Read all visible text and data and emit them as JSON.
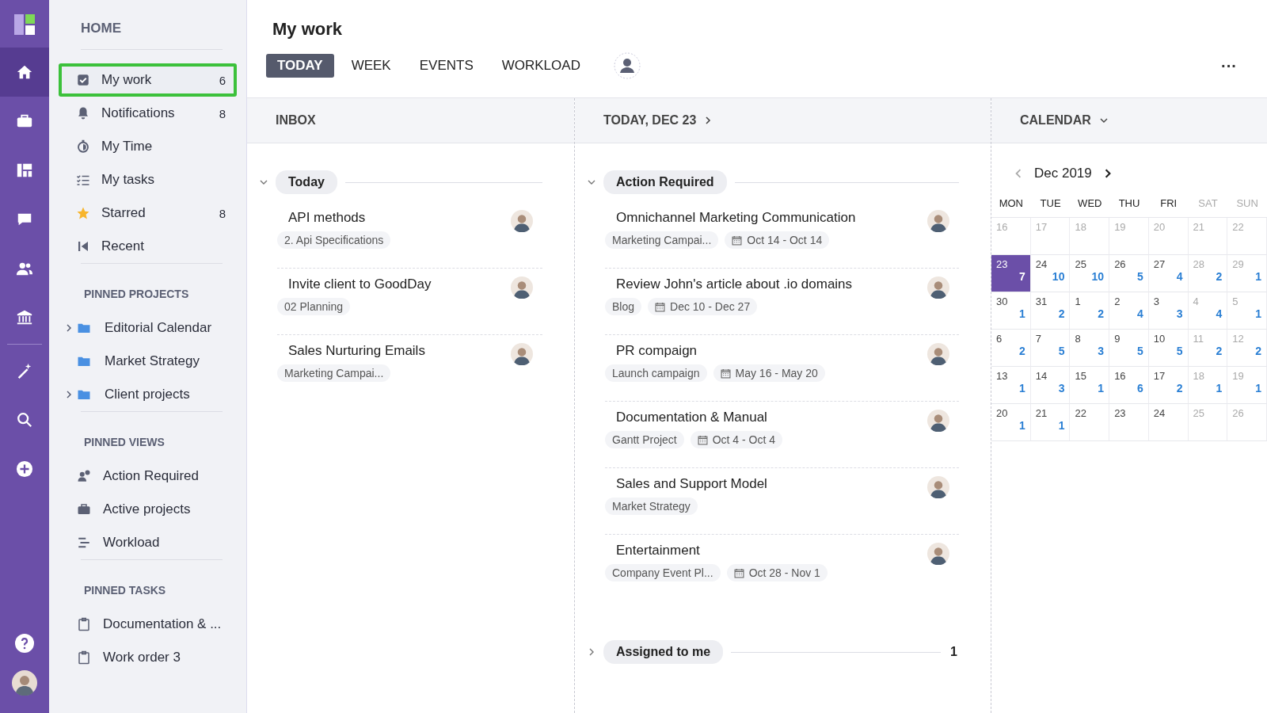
{
  "rail": {
    "items": [
      {
        "kind": "home",
        "selected": true
      },
      {
        "kind": "briefcase",
        "selected": false
      },
      {
        "kind": "board",
        "selected": false
      },
      {
        "kind": "chat",
        "selected": false
      },
      {
        "kind": "people",
        "selected": false
      },
      {
        "kind": "bank",
        "selected": false
      },
      {
        "kind": "wand",
        "selected": false
      },
      {
        "kind": "search",
        "selected": false
      },
      {
        "kind": "plus",
        "selected": false
      }
    ],
    "bottom": [
      {
        "kind": "help"
      },
      {
        "kind": "avatar"
      }
    ]
  },
  "sidebar": {
    "title": "HOME",
    "items": [
      {
        "kind": "check",
        "label": "My work",
        "count": "6",
        "selected": true
      },
      {
        "kind": "bell",
        "label": "Notifications",
        "count": "8",
        "selected": false
      },
      {
        "kind": "timer",
        "label": "My Time",
        "selected": false
      },
      {
        "kind": "list",
        "label": "My tasks",
        "selected": false
      },
      {
        "kind": "star",
        "label": "Starred",
        "count": "8",
        "selected": false
      },
      {
        "kind": "recent",
        "label": "Recent",
        "selected": false
      }
    ],
    "sections": [
      {
        "title": "PINNED PROJECTS",
        "items": [
          {
            "kind": "folder",
            "label": "Editorial Calendar",
            "collapsible": true
          },
          {
            "kind": "folder",
            "label": "Market Strategy",
            "collapsible": false
          },
          {
            "kind": "folder",
            "label": "Client projects",
            "collapsible": true
          }
        ]
      },
      {
        "title": "PINNED VIEWS",
        "items": [
          {
            "kind": "person-alert",
            "label": "Action Required",
            "collapsible": false
          },
          {
            "kind": "briefcase",
            "label": "Active projects",
            "collapsible": false
          },
          {
            "kind": "workload",
            "label": "Workload",
            "collapsible": false
          }
        ]
      },
      {
        "title": "PINNED TASKS",
        "items": [
          {
            "kind": "clipboard",
            "label": "Documentation & ...",
            "collapsible": false
          },
          {
            "kind": "clipboard",
            "label": "Work order 3",
            "collapsible": false
          }
        ]
      }
    ]
  },
  "header": {
    "title": "My work",
    "tabs": [
      {
        "label": "TODAY",
        "selected": true
      },
      {
        "label": "WEEK",
        "selected": false
      },
      {
        "label": "EVENTS",
        "selected": false
      },
      {
        "label": "WORKLOAD",
        "selected": false
      }
    ],
    "more": "···"
  },
  "inbox": {
    "title": "INBOX",
    "groups": [
      {
        "label": "Today",
        "expanded": true,
        "tasks": [
          {
            "title": "API methods",
            "tags": [
              {
                "kind": "project",
                "text": "2. Api Specifications"
              }
            ]
          },
          {
            "title": "Invite client to GoodDay",
            "tags": [
              {
                "kind": "project",
                "text": "02 Planning"
              }
            ]
          },
          {
            "title": "Sales Nurturing Emails",
            "tags": [
              {
                "kind": "project",
                "text": "Marketing Campai..."
              }
            ]
          }
        ]
      }
    ]
  },
  "today": {
    "title": "TODAY, DEC 23",
    "groups": [
      {
        "label": "Action Required",
        "expanded": true,
        "tasks": [
          {
            "title": "Omnichannel Marketing Communication",
            "tags": [
              {
                "kind": "project",
                "text": "Marketing Campai..."
              },
              {
                "kind": "date",
                "text": "Oct 14 - Oct 14"
              }
            ]
          },
          {
            "title": "Review John's article about .io domains",
            "tags": [
              {
                "kind": "project",
                "text": "Blog"
              },
              {
                "kind": "date",
                "text": "Dec 10 - Dec 27"
              }
            ]
          },
          {
            "title": "PR compaign",
            "tags": [
              {
                "kind": "project",
                "text": "Launch campaign"
              },
              {
                "kind": "date",
                "text": "May 16 - May 20"
              }
            ]
          },
          {
            "title": "Documentation & Manual",
            "tags": [
              {
                "kind": "project",
                "text": "Gantt Project"
              },
              {
                "kind": "date",
                "text": "Oct 4 - Oct 4"
              }
            ]
          },
          {
            "title": "Sales and Support Model",
            "tags": [
              {
                "kind": "project",
                "text": "Market Strategy"
              }
            ]
          },
          {
            "title": "Entertainment",
            "tags": [
              {
                "kind": "project",
                "text": "Company Event Pl..."
              },
              {
                "kind": "date",
                "text": "Oct 28 - Nov 1"
              }
            ]
          }
        ]
      },
      {
        "label": "Assigned to me",
        "expanded": false,
        "count": "1"
      }
    ]
  },
  "calendar": {
    "title": "CALENDAR",
    "month": "Dec 2019",
    "weekdays": [
      {
        "label": "MON",
        "weekend": false
      },
      {
        "label": "TUE",
        "weekend": false
      },
      {
        "label": "WED",
        "weekend": false
      },
      {
        "label": "THU",
        "weekend": false
      },
      {
        "label": "FRI",
        "weekend": false
      },
      {
        "label": "SAT",
        "weekend": true
      },
      {
        "label": "SUN",
        "weekend": true
      }
    ],
    "weeks": [
      [
        {
          "day": "16",
          "dim": true,
          "selected": false
        },
        {
          "day": "17",
          "dim": true,
          "selected": false
        },
        {
          "day": "18",
          "dim": true,
          "selected": false
        },
        {
          "day": "19",
          "dim": true,
          "selected": false
        },
        {
          "day": "20",
          "dim": true,
          "selected": false
        },
        {
          "day": "21",
          "dim": true,
          "selected": false
        },
        {
          "day": "22",
          "dim": true,
          "selected": false
        }
      ],
      [
        {
          "day": "23",
          "count": "7",
          "dim": false,
          "selected": true
        },
        {
          "day": "24",
          "count": "10",
          "dim": false,
          "selected": false
        },
        {
          "day": "25",
          "count": "10",
          "dim": false,
          "selected": false
        },
        {
          "day": "26",
          "count": "5",
          "dim": false,
          "selected": false
        },
        {
          "day": "27",
          "count": "4",
          "dim": false,
          "selected": false
        },
        {
          "day": "28",
          "count": "2",
          "dim": true,
          "selected": false
        },
        {
          "day": "29",
          "count": "1",
          "dim": true,
          "selected": false
        }
      ],
      [
        {
          "day": "30",
          "count": "1",
          "dim": false,
          "selected": false
        },
        {
          "day": "31",
          "count": "2",
          "dim": false,
          "selected": false
        },
        {
          "day": "1",
          "count": "2",
          "dim": false,
          "selected": false
        },
        {
          "day": "2",
          "count": "4",
          "dim": false,
          "selected": false
        },
        {
          "day": "3",
          "count": "3",
          "dim": false,
          "selected": false
        },
        {
          "day": "4",
          "count": "4",
          "dim": true,
          "selected": false
        },
        {
          "day": "5",
          "count": "1",
          "dim": true,
          "selected": false
        }
      ],
      [
        {
          "day": "6",
          "count": "2",
          "dim": false,
          "selected": false
        },
        {
          "day": "7",
          "count": "5",
          "dim": false,
          "selected": false
        },
        {
          "day": "8",
          "count": "3",
          "dim": false,
          "selected": false
        },
        {
          "day": "9",
          "count": "5",
          "dim": false,
          "selected": false
        },
        {
          "day": "10",
          "count": "5",
          "dim": false,
          "selected": false
        },
        {
          "day": "11",
          "count": "2",
          "dim": true,
          "selected": false
        },
        {
          "day": "12",
          "count": "2",
          "dim": true,
          "selected": false
        }
      ],
      [
        {
          "day": "13",
          "count": "1",
          "dim": false,
          "selected": false
        },
        {
          "day": "14",
          "count": "3",
          "dim": false,
          "selected": false
        },
        {
          "day": "15",
          "count": "1",
          "dim": false,
          "selected": false
        },
        {
          "day": "16",
          "count": "6",
          "dim": false,
          "selected": false
        },
        {
          "day": "17",
          "count": "2",
          "dim": false,
          "selected": false
        },
        {
          "day": "18",
          "count": "1",
          "dim": true,
          "selected": false
        },
        {
          "day": "19",
          "count": "1",
          "dim": true,
          "selected": false
        }
      ],
      [
        {
          "day": "20",
          "count": "1",
          "dim": false,
          "selected": false
        },
        {
          "day": "21",
          "count": "1",
          "dim": false,
          "selected": false
        },
        {
          "day": "22",
          "dim": false,
          "selected": false
        },
        {
          "day": "23",
          "dim": false,
          "selected": false
        },
        {
          "day": "24",
          "dim": false,
          "selected": false
        },
        {
          "day": "25",
          "dim": true,
          "selected": false
        },
        {
          "day": "26",
          "dim": true,
          "selected": false
        }
      ]
    ]
  }
}
